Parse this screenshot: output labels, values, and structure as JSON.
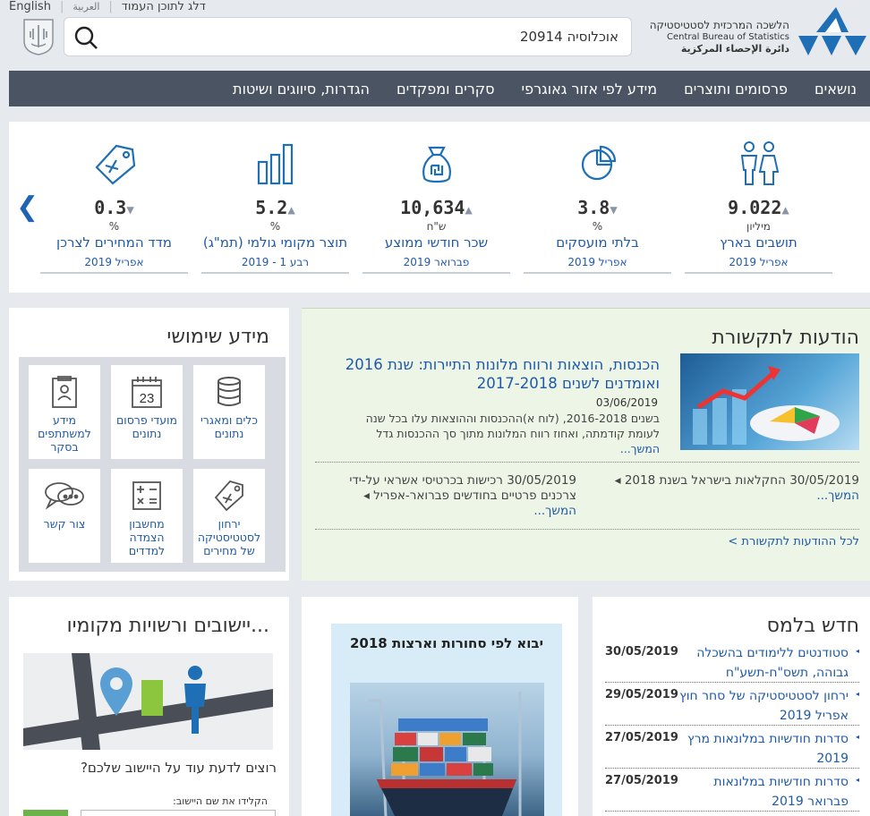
{
  "top": {
    "english": "English",
    "arabic": "العربية",
    "skip": "דלג לתוכן העמוד"
  },
  "search": {
    "value": "אוכלוסיה 20914"
  },
  "logo": {
    "hebrew": "הלשכה המרכזית לסטטיסטיקה",
    "english": "Central Bureau of Statistics",
    "arabic": "دائرة الإحصاء المركزية"
  },
  "nav": [
    "נושאים",
    "פרסומים ותוצרים",
    "מידע לפי אזור גאוגרפי",
    "סקרים ומפקדים",
    "הגדרות, סיווגים ושיטות"
  ],
  "stats": [
    {
      "value": "9.022",
      "trend": "up",
      "unit": "מיליון",
      "label": "תושבים בארץ",
      "date": "אפריל 2019",
      "icon": "people-icon"
    },
    {
      "value": "3.8",
      "trend": "down",
      "unit": "%",
      "label": "בלתי מועסקים",
      "date": "אפריל 2019",
      "icon": "pie-chart-icon"
    },
    {
      "value": "10,634",
      "trend": "up",
      "unit": "ש\"ח",
      "label": "שכר חודשי ממוצע",
      "date": "פברואר 2019",
      "icon": "money-bag-icon"
    },
    {
      "value": "5.2",
      "trend": "up",
      "unit": "%",
      "label": "תוצר מקומי גולמי (תמ\"ג)",
      "date": "רבע 1 - 2019",
      "icon": "bar-chart-icon"
    },
    {
      "value": "0.3",
      "trend": "down",
      "unit": "%",
      "label": "מדד המחירים לצרכן",
      "date": "אפריל 2019",
      "icon": "price-tag-icon"
    }
  ],
  "useful": {
    "title": "מידע שימושי",
    "tiles": [
      "כלים ומאגרי נתונים",
      "מועדי פרסום נתונים",
      "מידע למשתתפים בסקר",
      "ירחון לסטטיסטיקה של מחירים",
      "מחשבון הצמדה למדדים",
      "צור קשר"
    ]
  },
  "press": {
    "title": "הודעות לתקשורת",
    "main_title": "הכנסות, הוצאות ורווח מלונות התיירות: שנת 2016 ואומדנים לשנים 2017-2018",
    "main_date": "03/06/2019",
    "main_body": "בשנים 2016-2018, (לוח א)ההכנסות וההוצאות עלו בכל שנה לעומת קודמתה, ואחוז רווח המלונות מתוך סך ההכנסות גדל",
    "more": "המשך...",
    "sub1": "30/05/2019 החקלאות בישראל בשנת 2018",
    "sub2": "30/05/2019 רכישות בכרטיסי אשראי על-ידי צרכנים פרטיים בחודשים פברואר-אפריל",
    "all": "לכל ההודעות לתקשורת >"
  },
  "local": {
    "title": "יישובים ורשויות מקומיו...",
    "question": "רוצים לדעת עוד על היישוב שלכם?",
    "hint": "הקלידו את שם היישוב:"
  },
  "pub": {
    "title": "יבוא לפי סחורות וארצות 2018"
  },
  "news": {
    "title": "חדש בלמס",
    "items": [
      {
        "date": "30/05/2019",
        "text": "סטודנטים ללימודים בהשכלה גבוהה, תשס\"ח-תשע\"ח"
      },
      {
        "date": "29/05/2019",
        "text": "ירחון לסטטיסטיקה של סחר חוץ אפריל 2019"
      },
      {
        "date": "27/05/2019",
        "text": "סדרות חודשיות במלונאות מרץ 2019"
      },
      {
        "date": "27/05/2019",
        "text": "סדרות חודשיות במלונאות פברואר 2019"
      }
    ]
  },
  "colors": {
    "nav": "#4a5463",
    "link": "#1f5aa8",
    "press_bg": "#ecf5e6",
    "logo": "#1e6fb5"
  }
}
